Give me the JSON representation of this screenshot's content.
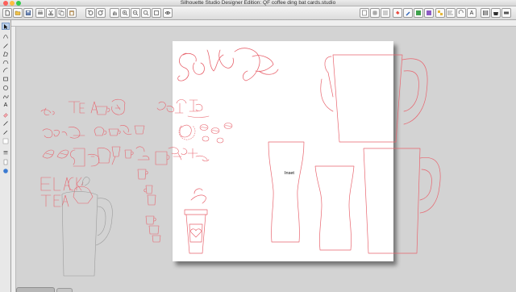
{
  "window": {
    "title": "Silhouette Studio Designer Edition: QF coffee ding bat cards.studio"
  },
  "toolbar": {
    "zoom_in_icon": "zoom-in-icon",
    "zoom_out_icon": "zoom-out-icon"
  },
  "canvas": {
    "inset_label": "Inset"
  },
  "colors": {
    "cut_line": "#e8646e",
    "grey_outline": "#9c9c9c",
    "mat": "#ffffff",
    "workspace": "#d3d3d3"
  }
}
